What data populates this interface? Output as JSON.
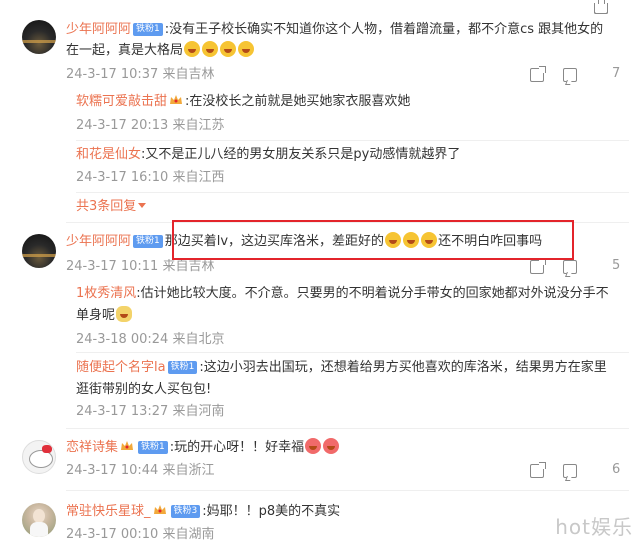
{
  "comments": [
    {
      "user": "少年阿阿阿",
      "badge": "铁粉1",
      "text_line1": ":没有王子校长确实不知道你这个人物，借着蹭流量，都不介意cs 跟其他女的",
      "text_line2": "在一起，真是大格局",
      "meta": "24-3-17 10:37 来自吉林",
      "likes": "7",
      "replies": [
        {
          "user": "软糯可爱敲击甜",
          "text": ":在没校长之前就是她买她家衣服喜欢她",
          "meta": "24-3-17 20:13 来自江苏"
        },
        {
          "user": "和花是仙女",
          "text": ":又不是正儿八经的男女朋友关系只是py动感情就越界了",
          "meta": "24-3-17 16:10 来自江西"
        }
      ],
      "more_replies": "共3条回复"
    },
    {
      "user": "少年阿阿阿",
      "badge": "铁粉1",
      "text_a": "那边买着lv，这边买库洛米，差距好的",
      "text_b": "还不明白咋回事吗",
      "meta": "24-3-17 10:11 来自吉林",
      "likes": "5",
      "replies": [
        {
          "user": "1枚秀清风",
          "text_line1": ":估计她比较大度。不介意。只要男的不明着说分手带女的回家她都对外说没分手不",
          "text_line2": "单身呢",
          "meta": "24-3-18 00:24 来自北京"
        },
        {
          "user": "随便起个名字la",
          "badge": "铁粉1",
          "text_line1": ":这边小羽去出国玩，还想着给男方买他喜欢的库洛米，结果男方在家里",
          "text_line2": "逛街带别的女人买包包!",
          "meta": "24-3-17 13:27 来自河南"
        }
      ]
    },
    {
      "user": "恋祥诗集",
      "badge": "铁粉1",
      "text": ":玩的开心呀！！好幸福",
      "meta": "24-3-17 10:44 来自浙江",
      "likes": "6"
    },
    {
      "user": "常驻快乐星球_",
      "badge": "铁粉3",
      "text": ":妈耶！！p8美的不真实",
      "meta": "24-3-17 00:10 来自湖南"
    }
  ],
  "watermark": "hot娱乐",
  "colors": {
    "username": "#eb7350",
    "meta": "#999999",
    "badge": "#5e9bf0",
    "highlight": "#e3242b"
  },
  "icons": [
    "share-icon",
    "reply-icon",
    "thumbs-up-icon",
    "crown-icon",
    "laugh-emoji",
    "cat-emoji",
    "heart-face-emoji"
  ]
}
